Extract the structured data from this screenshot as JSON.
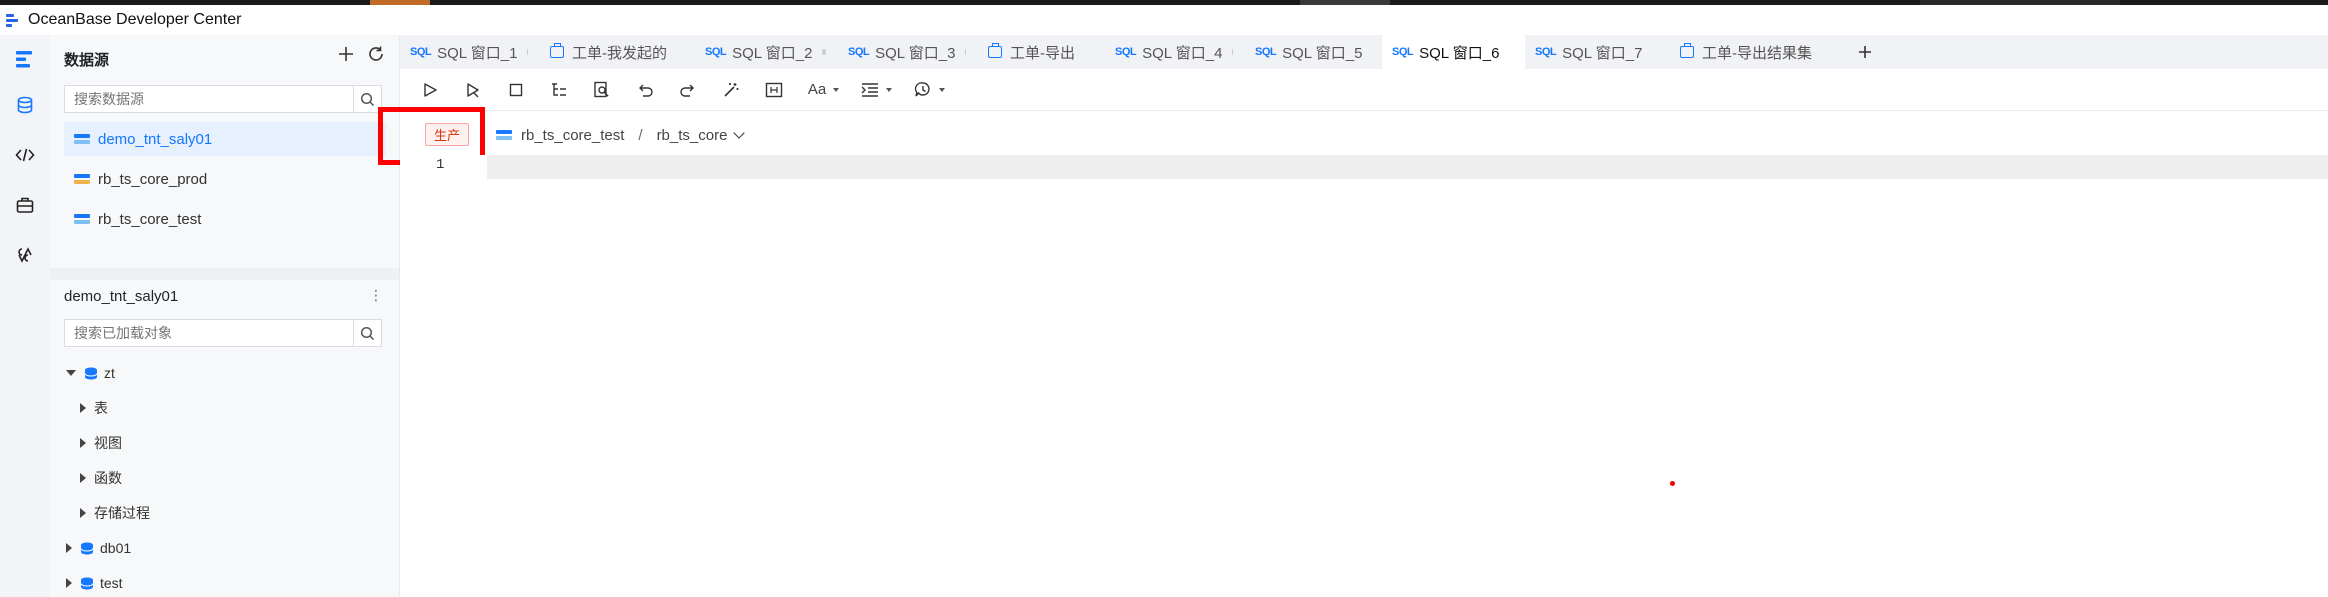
{
  "app": {
    "title": "OceanBase Developer Center"
  },
  "colors": {
    "accent": "#1677ff",
    "highlight_border": "#ff0000",
    "env_badge": "#d4380d"
  },
  "activity_bar": [
    {
      "name": "logo-icon"
    },
    {
      "name": "database-icon"
    },
    {
      "name": "code-icon"
    },
    {
      "name": "ticket-icon"
    },
    {
      "name": "plugin-icon"
    }
  ],
  "sidebar": {
    "title": "数据源",
    "search_placeholder": "搜索数据源",
    "datasources": [
      {
        "label": "demo_tnt_saly01",
        "active": true
      },
      {
        "label": "rb_ts_core_prod",
        "active": false
      },
      {
        "label": "rb_ts_core_test",
        "active": false
      }
    ],
    "db_panel": {
      "title": "demo_tnt_saly01",
      "search_placeholder": "搜索已加载对象",
      "tree": [
        {
          "label": "zt",
          "expanded": true
        },
        {
          "label": "表"
        },
        {
          "label": "视图"
        },
        {
          "label": "函数"
        },
        {
          "label": "存储过程"
        },
        {
          "label": "db01",
          "expanded": false
        },
        {
          "label": "test",
          "expanded": false
        }
      ]
    }
  },
  "tabs": [
    {
      "prefix": "SQL",
      "label": "SQL 窗口_1",
      "type": "sql",
      "dot": true
    },
    {
      "prefix": "",
      "label": "工单-我发起的",
      "type": "ticket",
      "dot": false
    },
    {
      "prefix": "SQL",
      "label": "SQL 窗口_2",
      "type": "sql",
      "dot": true
    },
    {
      "prefix": "SQL",
      "label": "SQL 窗口_3",
      "type": "sql",
      "dot": true
    },
    {
      "prefix": "",
      "label": "工单-导出",
      "type": "ticket",
      "dot": false
    },
    {
      "prefix": "SQL",
      "label": "SQL 窗口_4",
      "type": "sql",
      "dot": true
    },
    {
      "prefix": "SQL",
      "label": "SQL 窗口_5",
      "type": "sql",
      "dot": false
    },
    {
      "prefix": "SQL",
      "label": "SQL 窗口_6",
      "type": "sql",
      "dot": false,
      "active": true
    },
    {
      "prefix": "SQL",
      "label": "SQL 窗口_7",
      "type": "sql",
      "dot": false
    },
    {
      "prefix": "",
      "label": "工单-导出结果集",
      "type": "ticket",
      "dot": false
    }
  ],
  "toolbar": {
    "buttons": [
      "run-icon",
      "run-selection-icon",
      "stop-icon",
      "plan-icon",
      "find-icon",
      "undo-icon",
      "redo-icon",
      "beautify-icon",
      "snippet-icon",
      "case-icon",
      "indent-icon",
      "toggle-comment-icon"
    ],
    "case_label": "Aa"
  },
  "context": {
    "env_label": "生产",
    "connection": "rb_ts_core_test",
    "separator": "/",
    "database": "rb_ts_core"
  },
  "editor": {
    "line_numbers": [
      "1"
    ]
  }
}
